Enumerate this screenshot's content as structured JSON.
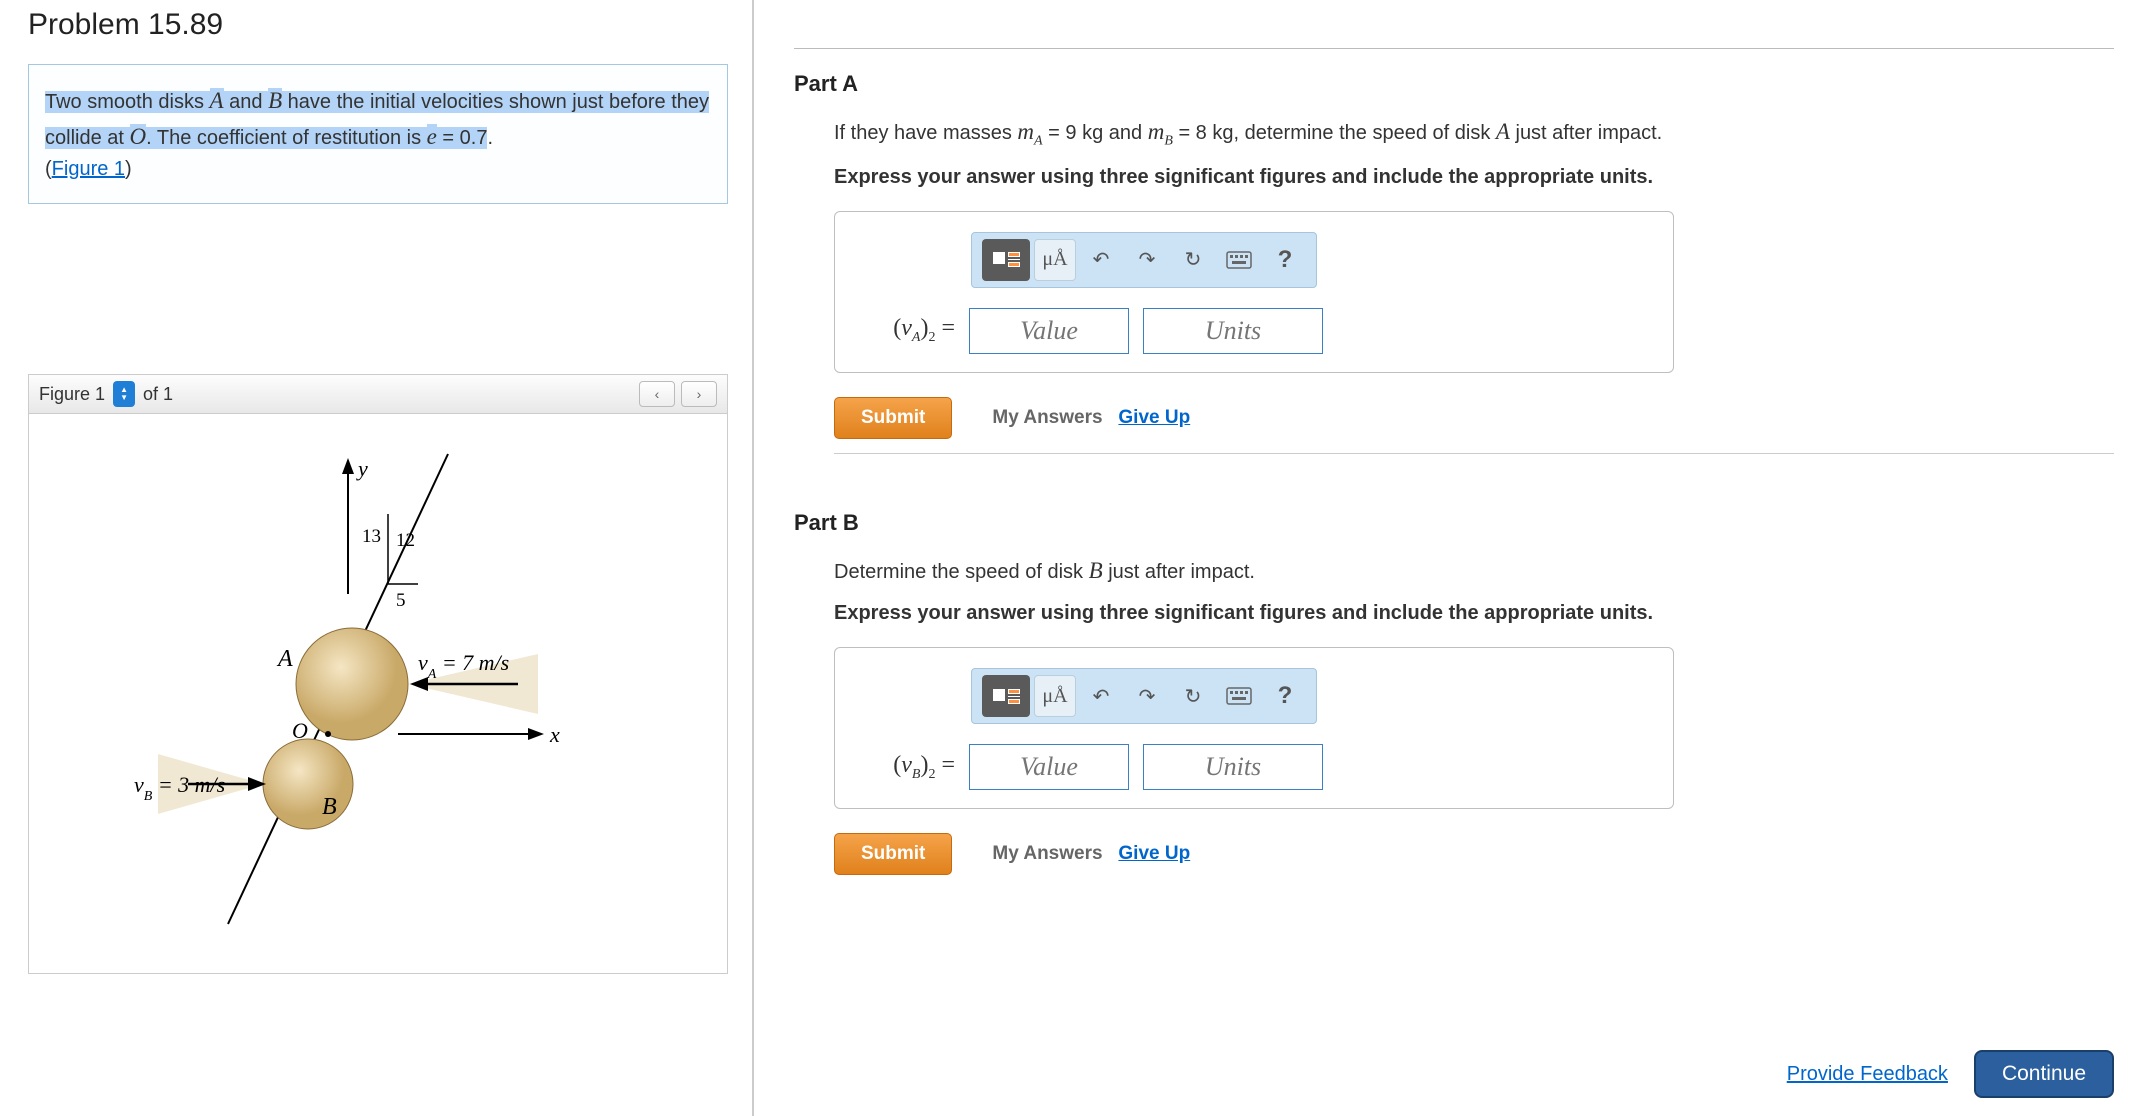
{
  "problem": {
    "title": "Problem 15.89",
    "highlighted_1": "Two smooth disks ",
    "var_A": "A",
    "highlighted_2": " and ",
    "var_B": "B",
    "highlighted_3": " have the initial velocities shown just before they collide at ",
    "var_O": "O",
    "highlighted_4": ". The coefficient of restitution is ",
    "var_e": "e",
    "highlighted_5": " = 0.7",
    "rest": ".",
    "figure_link": "Figure 1"
  },
  "figure": {
    "label": "Figure 1",
    "of_text": "of 1",
    "diagram": {
      "y_label": "y",
      "x_label": "x",
      "A_label": "A",
      "B_label": "B",
      "O_label": "O",
      "vA_label": "vA = 7 m/s",
      "vB_label": "vB = 3 m/s",
      "tri_hyp": "13",
      "tri_v": "12",
      "tri_h": "5"
    }
  },
  "part_a": {
    "header": "Part A",
    "text_pre": "If they have masses ",
    "mA_expr": "mA",
    "mA_val": " = 9 kg",
    "and_text": " and ",
    "mB_expr": "mB",
    "mB_val": " = 8 kg",
    "text_post": ", determine the speed of disk ",
    "var_A": "A",
    "text_end": " just after impact.",
    "instruction": "Express your answer using three significant figures and include the appropriate units.",
    "answer_label": "(vA)2 =",
    "value_placeholder": "Value",
    "units_placeholder": "Units",
    "units_btn": "μÅ"
  },
  "part_b": {
    "header": "Part B",
    "text": "Determine the speed of disk ",
    "var_B": "B",
    "text_end": " just after impact.",
    "instruction": "Express your answer using three significant figures and include the appropriate units.",
    "answer_label": "(vB)2 =",
    "value_placeholder": "Value",
    "units_placeholder": "Units",
    "units_btn": "μÅ"
  },
  "common": {
    "submit": "Submit",
    "my_answers": "My Answers",
    "give_up": "Give Up",
    "help": "?",
    "feedback": "Provide Feedback",
    "continue": "Continue"
  }
}
